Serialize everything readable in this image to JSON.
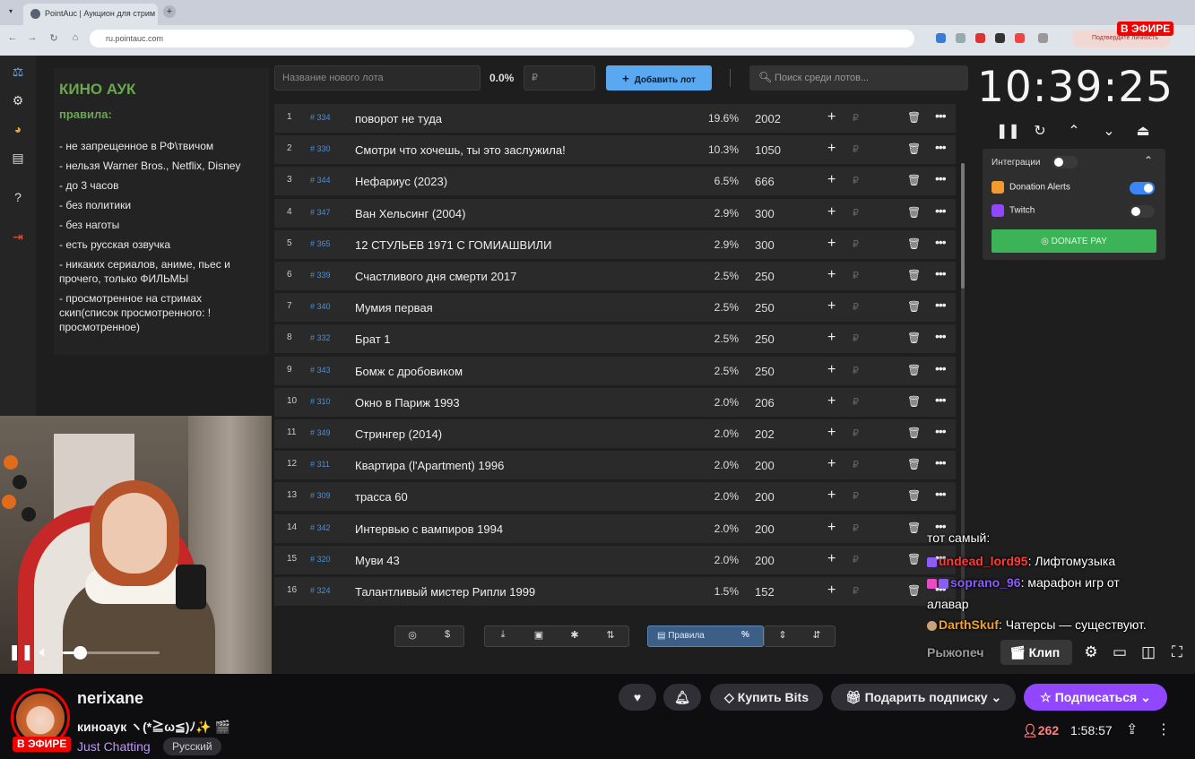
{
  "browser": {
    "tab_title": "PointAuc | Аукцион для стрим",
    "url": "ru.pointauc.com",
    "profile": "Подтвердите личность"
  },
  "app": {
    "rules": {
      "title": "КИНО АУК",
      "subtitle": "правила:",
      "items": [
        "- не запрещенное в РФ\\твичом",
        "- нельзя Warner Bros., Netflix, Disney",
        "- до 3 часов",
        "- без политики",
        "- без наготы",
        "- есть русская озвучка",
        "- никаких сериалов, аниме, пьес и прочего, только ФИЛЬМЫ",
        "- просмотренное на стримах скип(список просмотренного: !просмотренное)"
      ]
    },
    "topbar": {
      "lot_placeholder": "Название нового лота",
      "percent": "0.0%",
      "amount_placeholder": "₽",
      "add_label": "Добавить лот",
      "search_placeholder": "Поиск среди лотов..."
    },
    "lots": [
      {
        "n": "1",
        "id": "334",
        "title": "поворот не туда",
        "pct": "19.6%",
        "amount": "2002"
      },
      {
        "n": "2",
        "id": "330",
        "title": "Смотри что хочешь, ты это заслужила!",
        "pct": "10.3%",
        "amount": "1050"
      },
      {
        "n": "3",
        "id": "344",
        "title": "Нефариус (2023)",
        "pct": "6.5%",
        "amount": "666"
      },
      {
        "n": "4",
        "id": "347",
        "title": "Ван Хельсинг (2004)",
        "pct": "2.9%",
        "amount": "300"
      },
      {
        "n": "5",
        "id": "365",
        "title": "12 СТУЛЬЕВ 1971 С ГОМИАШВИЛИ",
        "pct": "2.9%",
        "amount": "300"
      },
      {
        "n": "6",
        "id": "339",
        "title": "Счастливого дня смерти 2017",
        "pct": "2.5%",
        "amount": "250"
      },
      {
        "n": "7",
        "id": "340",
        "title": "Мумия первая",
        "pct": "2.5%",
        "amount": "250"
      },
      {
        "n": "8",
        "id": "332",
        "title": "Брат 1",
        "pct": "2.5%",
        "amount": "250"
      },
      {
        "n": "9",
        "id": "343",
        "title": "Бомж с дробовиком",
        "pct": "2.5%",
        "amount": "250"
      },
      {
        "n": "10",
        "id": "310",
        "title": "Окно в Париж 1993",
        "pct": "2.0%",
        "amount": "206"
      },
      {
        "n": "11",
        "id": "349",
        "title": "Стрингер (2014)",
        "pct": "2.0%",
        "amount": "202"
      },
      {
        "n": "12",
        "id": "311",
        "title": "Квартира (l'Apartment) 1996",
        "pct": "2.0%",
        "amount": "200"
      },
      {
        "n": "13",
        "id": "309",
        "title": "трасса 60",
        "pct": "2.0%",
        "amount": "200"
      },
      {
        "n": "14",
        "id": "342",
        "title": "Интервью с вампиров 1994",
        "pct": "2.0%",
        "amount": "200"
      },
      {
        "n": "15",
        "id": "320",
        "title": "Муви 43",
        "pct": "2.0%",
        "amount": "200"
      },
      {
        "n": "16",
        "id": "324",
        "title": "Талантливый мистер Рипли 1999",
        "pct": "1.5%",
        "amount": "152"
      }
    ],
    "row_icons": {
      "plus": "+",
      "rub": "₽",
      "del": "🗑",
      "more": "•••"
    },
    "toolbar": {
      "rules_label": "Правила",
      "percent_icon": "%"
    },
    "timer": {
      "time": "10:39:25"
    },
    "integrations": {
      "label": "Интеграции",
      "donation_alerts": "Donation Alerts",
      "twitch": "Twitch",
      "donate_pay": "DONATE PAY"
    }
  },
  "chat": [
    {
      "user": "",
      "text": "тот самый:"
    },
    {
      "user": "undead_lord95",
      "text": "Лифтомузыка",
      "color": "#ff3b3b"
    },
    {
      "user": "soprano_96",
      "text": "марафон игр от",
      "color": "#8b5cf6"
    },
    {
      "user": "",
      "text": "алавар"
    },
    {
      "user": "DarthSkuf",
      "text": "Чатерсы — существуют.",
      "color": "#f0a030"
    },
    {
      "user": "Рыжопеч",
      "text": "",
      "color": "#bbbbbb"
    }
  ],
  "player": {
    "live_label": "В ЭФИРЕ",
    "clip_label": "Клип",
    "volume_level": 0.18
  },
  "channel": {
    "name": "nerixane",
    "title": "киноаук ヽ(*≧ω≦)ﾉ✨ 🎬",
    "category": "Just Chatting",
    "language": "Русский",
    "live_label": "В ЭФИРЕ",
    "viewers": "262",
    "uptime": "1:58:57",
    "buy_bits": "Купить Bits",
    "gift_sub": "Подарить подписку",
    "subscribe": "Подписаться"
  },
  "colors": {
    "twitch_purple": "#9147ff",
    "live_red": "#eb0400",
    "add_blue": "#5aa8f0",
    "donate_green": "#3cb356",
    "rules_green": "#6aa84f"
  }
}
